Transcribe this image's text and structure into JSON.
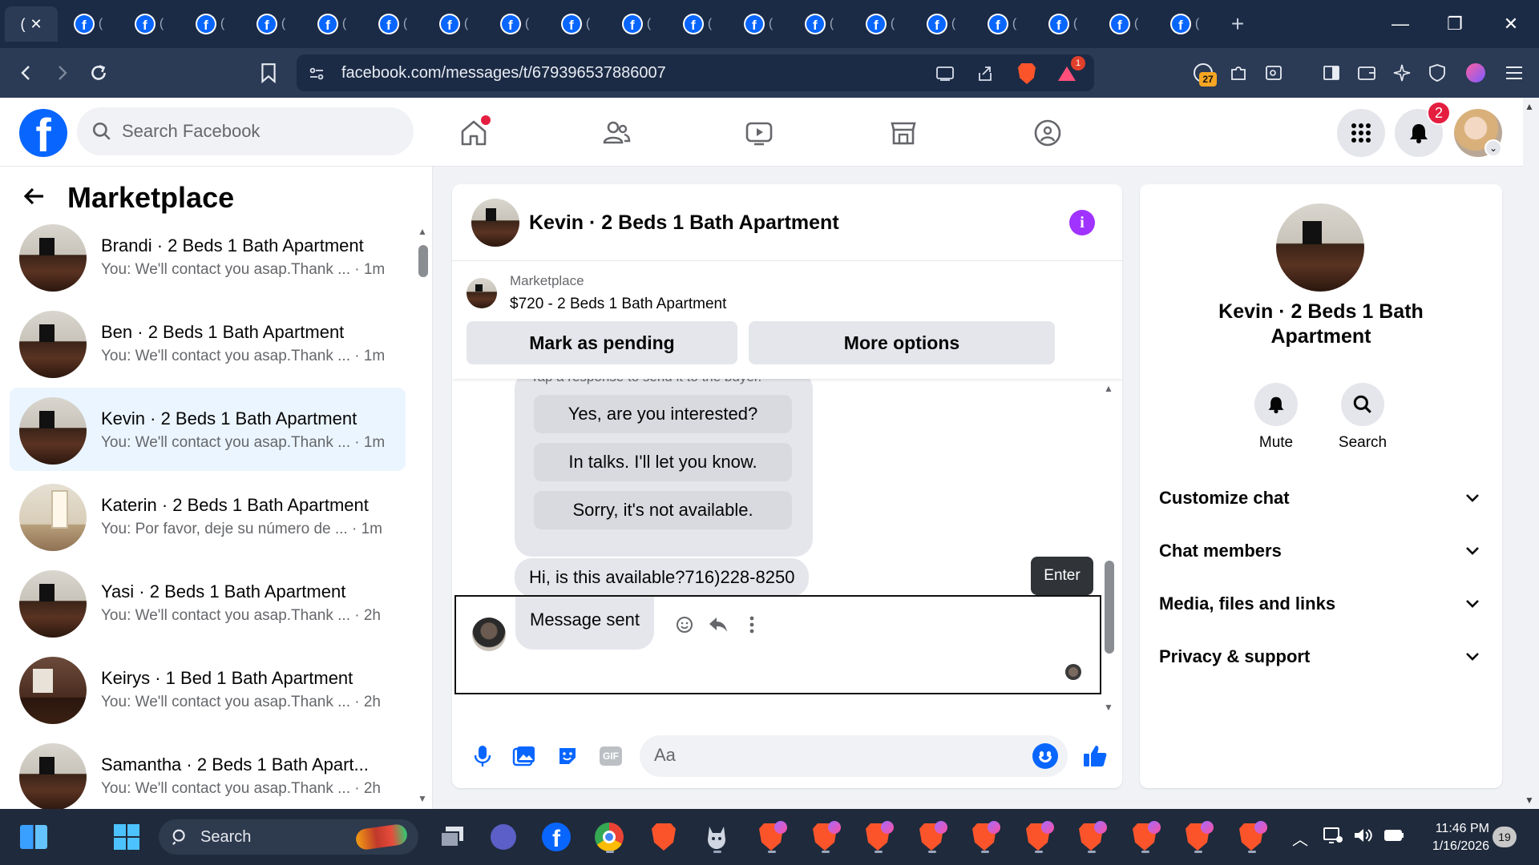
{
  "browser": {
    "tab_count_visible": 20,
    "active_tab_label": "(",
    "tab_label": "(",
    "url": "facebook.com/messages/t/679396537886007",
    "brave_rewards_badge": "1",
    "extension_badge": "27"
  },
  "facebook_header": {
    "search_placeholder": "Search Facebook",
    "notification_count": "2",
    "nav_icons": [
      "home-icon",
      "friends-icon",
      "video-icon",
      "marketplace-icon",
      "groups-icon"
    ]
  },
  "sidebar": {
    "title": "Marketplace",
    "conversations": [
      {
        "name": "Brandi · 2 Beds 1 Bath Apartment",
        "preview": "You: We'll contact you asap.Thank ... · 1m",
        "active": false,
        "thumb": "room"
      },
      {
        "name": "Ben · 2 Beds 1 Bath Apartment",
        "preview": "You: We'll contact you asap.Thank ... · 1m",
        "active": false,
        "thumb": "room"
      },
      {
        "name": "Kevin · 2 Beds 1 Bath Apartment",
        "preview": "You: We'll contact you asap.Thank ... · 1m",
        "active": true,
        "thumb": "room"
      },
      {
        "name": "Katerin · 2 Beds 1 Bath Apartment",
        "preview": "You: Por favor, deje su número de ... · 1m",
        "active": false,
        "thumb": "light"
      },
      {
        "name": "Yasi · 2 Beds 1 Bath Apartment",
        "preview": "You: We'll contact you asap.Thank ... · 2h",
        "active": false,
        "thumb": "room"
      },
      {
        "name": "Keirys · 1 Bed 1 Bath Apartment",
        "preview": "You: We'll contact you asap.Thank ... · 2h",
        "active": false,
        "thumb": "dark"
      },
      {
        "name": "Samantha · 2 Beds 1 Bath Apart...",
        "preview": "You: We'll contact you asap.Thank ... · 2h",
        "active": false,
        "thumb": "room"
      }
    ]
  },
  "chat": {
    "title": "Kevin · 2 Beds 1 Bath Apartment",
    "listing": {
      "label": "Marketplace",
      "title": "$720 - 2 Beds 1 Bath Apartment",
      "mark_pending_label": "Mark as pending",
      "more_options_label": "More options"
    },
    "quick_hint": "Tap a response to send it to the buyer.",
    "quick_replies": [
      "Yes, are you interested?",
      "In talks. I'll let you know.",
      "Sorry, it's not available."
    ],
    "incoming_message": "Hi, is this available?716)228-8250",
    "tooltip": "Enter",
    "sent_message": "Message sent",
    "composer_placeholder": "Aa"
  },
  "info_panel": {
    "name": "Kevin · 2 Beds 1 Bath Apartment",
    "mute_label": "Mute",
    "search_label": "Search",
    "sections": [
      "Customize chat",
      "Chat members",
      "Media, files and links",
      "Privacy & support"
    ]
  },
  "taskbar": {
    "search_label": "Search",
    "time": "11:46 PM",
    "date": "1/16/2026",
    "notification_count": "19"
  },
  "colors": {
    "fb_blue": "#0866ff",
    "chrome_dark": "#1c2b45",
    "chrome_toolbar": "#2b3a55",
    "active_conversation": "#ebf5ff",
    "info_purple": "#a033ff",
    "badge_red": "#e41e3f"
  }
}
